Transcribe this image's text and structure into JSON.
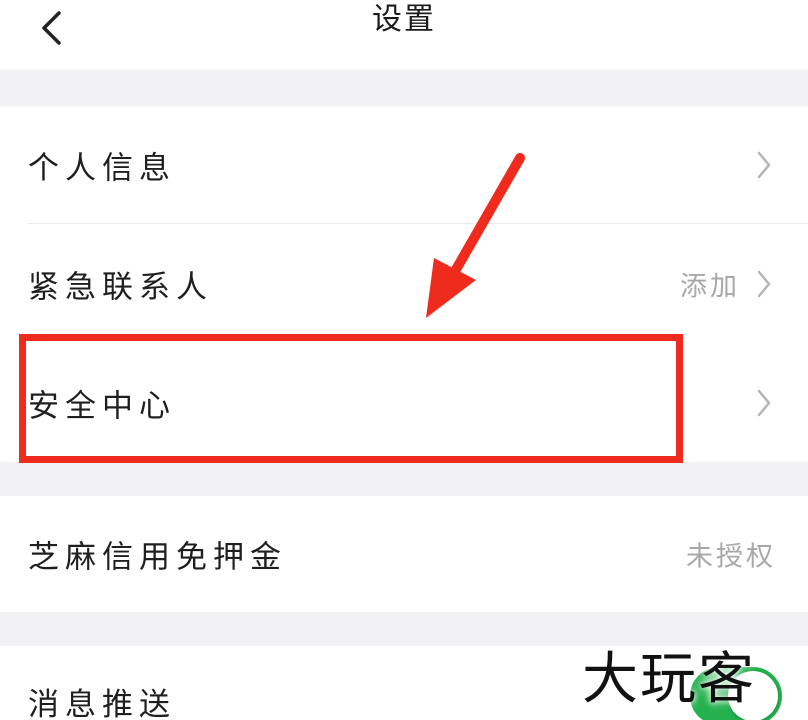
{
  "header": {
    "title": "设置",
    "back_icon": "chevron-left-icon"
  },
  "settings": {
    "rows": [
      {
        "label": "个人信息",
        "value": "",
        "icon": "chevron-right-icon"
      },
      {
        "label": "紧急联系人",
        "value": "添加",
        "icon": "chevron-right-icon"
      },
      {
        "label": "安全中心",
        "value": "",
        "icon": "chevron-right-icon"
      },
      {
        "label": "芝麻信用免押金",
        "value": "未授权"
      },
      {
        "label": "消息推送",
        "toggle": "on"
      }
    ]
  },
  "annotation": {
    "color": "#ee2b1d",
    "highlighted_row": "安全中心"
  },
  "colors": {
    "separator": "#f2f2f4",
    "value_text": "#a8a8a8",
    "toggle_on": "#22b14c"
  },
  "watermark": {
    "text": "大玩客"
  }
}
